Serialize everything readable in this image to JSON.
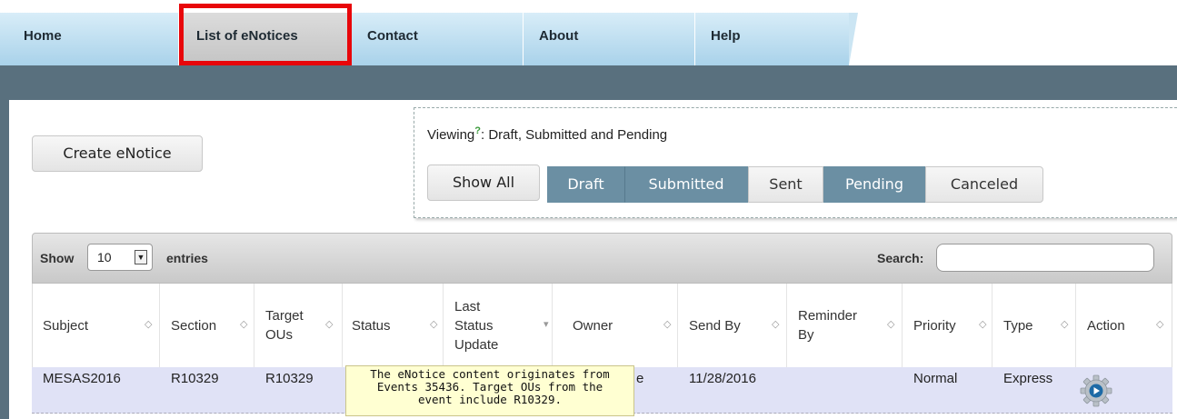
{
  "nav": {
    "tabs": [
      {
        "label": "Home"
      },
      {
        "label": "List of eNotices"
      },
      {
        "label": "Contact"
      },
      {
        "label": "About"
      },
      {
        "label": "Help"
      }
    ]
  },
  "create_button": "Create eNotice",
  "filter": {
    "viewing_label": "Viewing",
    "viewing_help": "?",
    "viewing_text": ": Draft, Submitted and Pending",
    "show_all": "Show All",
    "segments": [
      {
        "label": "Draft",
        "selected": true
      },
      {
        "label": "Submitted",
        "selected": true
      },
      {
        "label": "Sent",
        "selected": false
      },
      {
        "label": "Pending",
        "selected": true
      },
      {
        "label": "Canceled",
        "selected": false
      }
    ]
  },
  "table": {
    "show_label": "Show",
    "entries_value": "10",
    "entries_label": "entries",
    "search_label": "Search:",
    "search_value": "",
    "columns": [
      {
        "line1": "Subject"
      },
      {
        "line1": "Section"
      },
      {
        "line1": "Target",
        "line2": "OUs"
      },
      {
        "line1": "Status"
      },
      {
        "line1": "Last",
        "line2": "Status",
        "line3": "Update"
      },
      {
        "line1": "Owner"
      },
      {
        "line1": "Send By"
      },
      {
        "line1": "Reminder",
        "line2": "By"
      },
      {
        "line1": "Priority"
      },
      {
        "line1": "Type"
      },
      {
        "line1": "Action"
      }
    ],
    "rows": [
      {
        "subject": "MESAS2016",
        "section": "R10329",
        "target_ous": "R10329",
        "status": "",
        "last_status_update": "",
        "owner_partial": "e",
        "send_by": "11/28/2016",
        "reminder_by": "",
        "priority": "Normal",
        "type": "Express",
        "action_icon": "gear-icon"
      }
    ]
  },
  "tooltip": {
    "line1": "The eNotice content originates from",
    "line2": "Events 35436. Target OUs from the",
    "line3": "event include R10329."
  },
  "colors": {
    "nav_tab": "#bfe0f2",
    "nav_active": "#cfcfcf",
    "highlight": "#e8060a",
    "bar": "#59707e",
    "segment_on": "#6b8fa3",
    "row_bg": "#e0e2f6",
    "tooltip_bg": "#ffffd2"
  }
}
